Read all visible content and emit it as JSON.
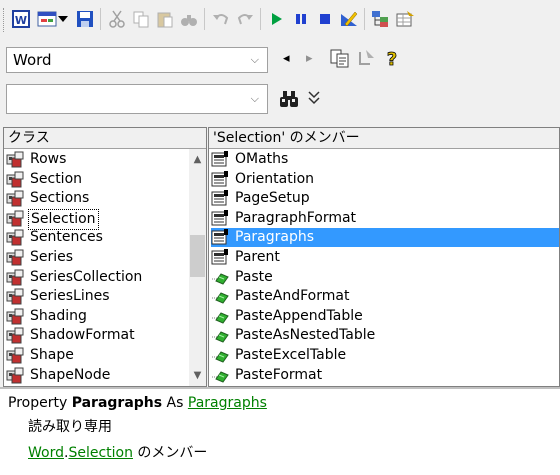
{
  "toolbar": {
    "icons": [
      "word-icon",
      "userform-icon",
      "dropdown-arrow-icon",
      "save-icon",
      "cut-icon",
      "copy-icon",
      "paste-icon",
      "find-icon",
      "undo-icon",
      "redo-icon",
      "run-icon",
      "break-icon",
      "reset-icon",
      "design-mode-icon",
      "project-explorer-icon",
      "properties-icon"
    ]
  },
  "library_combo": {
    "value": "Word",
    "arrow": "⌵"
  },
  "nav": {
    "back": "◂",
    "forward": "▸"
  },
  "search_combo": {
    "value": "",
    "arrow": "⌵"
  },
  "search": {
    "binoculars": "🔍",
    "toggle": "⌄⌄"
  },
  "classes": {
    "header": "クラス",
    "items": [
      {
        "label": "Rows"
      },
      {
        "label": "Section"
      },
      {
        "label": "Sections"
      },
      {
        "label": "Selection"
      },
      {
        "label": "Sentences"
      },
      {
        "label": "Series"
      },
      {
        "label": "SeriesCollection"
      },
      {
        "label": "SeriesLines"
      },
      {
        "label": "Shading"
      },
      {
        "label": "ShadowFormat"
      },
      {
        "label": "Shape"
      },
      {
        "label": "ShapeNode"
      }
    ],
    "selected_index": 3
  },
  "members": {
    "header": "'Selection' のメンバー",
    "items": [
      {
        "label": "OMaths",
        "kind": "property"
      },
      {
        "label": "Orientation",
        "kind": "property"
      },
      {
        "label": "PageSetup",
        "kind": "property"
      },
      {
        "label": "ParagraphFormat",
        "kind": "property"
      },
      {
        "label": "Paragraphs",
        "kind": "property"
      },
      {
        "label": "Parent",
        "kind": "property"
      },
      {
        "label": "Paste",
        "kind": "method"
      },
      {
        "label": "PasteAndFormat",
        "kind": "method"
      },
      {
        "label": "PasteAppendTable",
        "kind": "method"
      },
      {
        "label": "PasteAsNestedTable",
        "kind": "method"
      },
      {
        "label": "PasteExcelTable",
        "kind": "method"
      },
      {
        "label": "PasteFormat",
        "kind": "method"
      }
    ],
    "selected_index": 4
  },
  "details": {
    "prefix": "Property ",
    "name": "Paragraphs",
    "as": " As ",
    "type": "Paragraphs",
    "readonly": "読み取り専用",
    "lib": "Word",
    "dot": ".",
    "cls": "Selection",
    "member_of": " のメンバー"
  }
}
